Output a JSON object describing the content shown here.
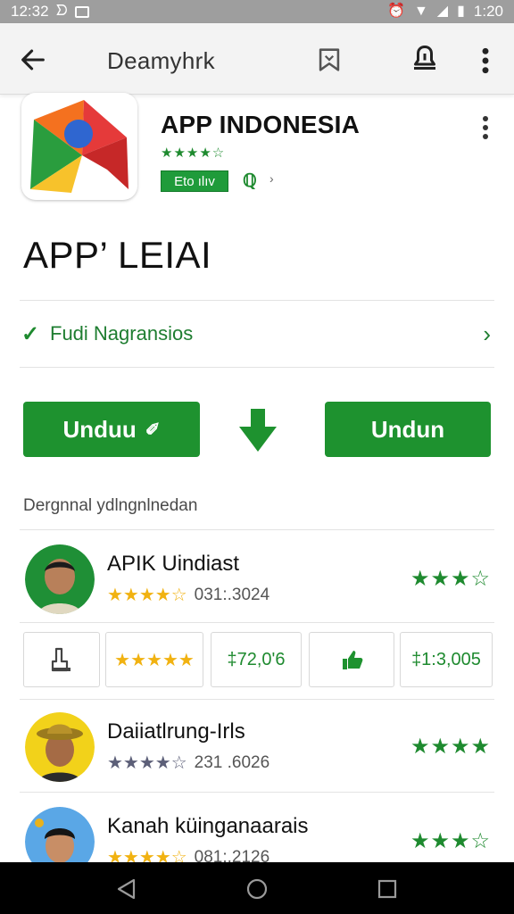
{
  "status_bar": {
    "time_left": "12:32",
    "time_right": "1:20"
  },
  "app_bar": {
    "title": "Deamyhrk"
  },
  "app": {
    "name": "APP INDONESIA",
    "stars": "★★★★☆",
    "badge": "Eto ılıv",
    "headline": "APP’ LEIAI",
    "verify_text": "Fudi Nagransios"
  },
  "buttons": {
    "left_label": "Unduu",
    "right_label": "Undun"
  },
  "section": {
    "label": "Dergnnal ydlngnlnedan"
  },
  "list": [
    {
      "name": "APIK Uindiast",
      "sub_stars": "★★★★☆",
      "sub_color": "#f1b211",
      "sub_number": "031:.3024",
      "right_stars": "★★★☆"
    },
    {
      "name": "Daiiatlrung-Irls",
      "sub_stars": "★★★★☆",
      "sub_color": "#5c5f78",
      "sub_number": "231 .6026",
      "right_stars": "★★★★"
    },
    {
      "name": "Kanah küinganaarais",
      "sub_stars": "★★★★☆",
      "sub_color": "#f1b211",
      "sub_number": "081:.2126",
      "right_stars": "★★★☆"
    }
  ],
  "tiles": {
    "stars": "★★★★★",
    "value_a": "‡72,0'6",
    "value_b": "‡1:3,005"
  },
  "colors": {
    "accent_green": "#1e922f",
    "status_bar": "#9e9e9e",
    "star_gold": "#f1b211"
  },
  "icons": {
    "back": "arrow-left-icon",
    "bookmark": "bookmark-icon",
    "share": "share-icon",
    "more": "more-vertical-icon",
    "download": "download-arrow-icon",
    "check": "check-icon",
    "chevron": "chevron-right-icon",
    "thumb": "thumb-up-icon",
    "save": "save-icon"
  }
}
